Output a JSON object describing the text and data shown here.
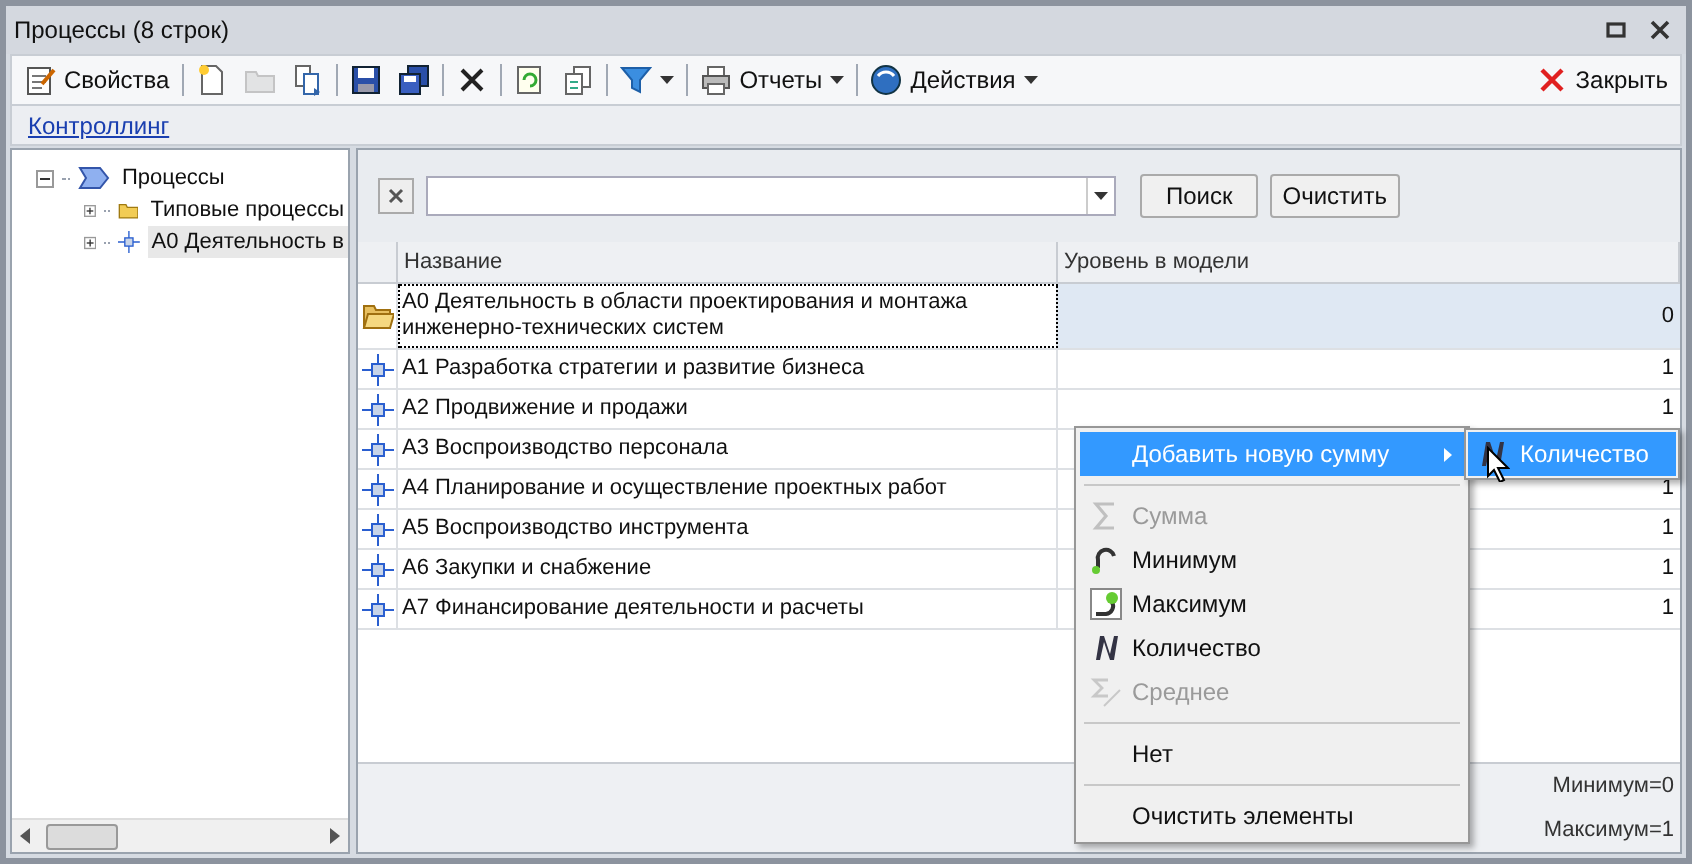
{
  "window": {
    "title": "Процессы (8 строк)"
  },
  "toolbar": [
    {
      "kind": "button",
      "label": "Свойства",
      "disabled": false
    },
    {
      "kind": "separator"
    },
    {
      "kind": "button",
      "disabled": false
    },
    {
      "kind": "button",
      "disabled": true
    },
    {
      "kind": "button",
      "disabled": false
    },
    {
      "kind": "separator"
    },
    {
      "kind": "button",
      "disabled": false
    },
    {
      "kind": "button",
      "disabled": false
    },
    {
      "kind": "separator"
    },
    {
      "kind": "button",
      "disabled": false
    },
    {
      "kind": "separator"
    },
    {
      "kind": "button",
      "disabled": false
    },
    {
      "kind": "button",
      "disabled": false
    },
    {
      "kind": "separator"
    },
    {
      "kind": "dropdown",
      "disabled": false
    },
    {
      "kind": "separator"
    },
    {
      "kind": "dropdown",
      "label": "Отчеты",
      "disabled": false
    },
    {
      "kind": "separator"
    },
    {
      "kind": "dropdown",
      "label": "Действия",
      "disabled": false
    }
  ],
  "close_button": "Закрыть",
  "breadcrumb": "Контроллинг",
  "tree": [
    {
      "kind": "root",
      "label": "Процессы",
      "expanded": true,
      "selected": false,
      "children": [
        {
          "kind": "folder",
          "label": "Типовые процессы",
          "expanded": false,
          "selected": false
        },
        {
          "kind": "process",
          "label": "А0 Деятельность в",
          "expanded": false,
          "selected": true
        }
      ]
    }
  ],
  "search": {
    "button": "Поиск",
    "clear_button": "Очистить"
  },
  "table": {
    "columns": [
      "Название",
      "Уровень в модели"
    ],
    "rows": [
      {
        "kind": "folder",
        "name": "А0 Деятельность в области проектирования и монтажа инженерно-технических систем",
        "level": "0",
        "selected": true
      },
      {
        "kind": "process",
        "name": "А1 Разработка стратегии и развитие бизнеса",
        "level": "1",
        "selected": false
      },
      {
        "kind": "process",
        "name": "А2 Продвижение и продажи",
        "level": "1",
        "selected": false
      },
      {
        "kind": "process",
        "name": "А3 Воспроизводство персонала",
        "selected": false
      },
      {
        "kind": "process",
        "name": "А4 Планирование и осуществление проектных работ",
        "level": "1",
        "selected": false
      },
      {
        "kind": "process",
        "name": "А5 Воспроизводство инструмента",
        "level": "1",
        "selected": false
      },
      {
        "kind": "process",
        "name": "А6 Закупки и снабжение",
        "level": "1",
        "selected": false
      },
      {
        "kind": "process",
        "name": "А7 Финансирование деятельности и расчеты",
        "level": "1",
        "selected": false
      }
    ],
    "totals": [
      "Минимум=0",
      "Максимум=1"
    ]
  },
  "context_menu": {
    "items": [
      {
        "kind": "submenu",
        "label": "Добавить новую сумму",
        "highlighted": true
      },
      {
        "kind": "separator"
      },
      {
        "kind": "item",
        "label": "Сумма",
        "disabled": true
      },
      {
        "kind": "item",
        "label": "Минимум",
        "disabled": false
      },
      {
        "kind": "item",
        "label": "Максимум",
        "disabled": false
      },
      {
        "kind": "item",
        "label": "Количество",
        "disabled": false
      },
      {
        "kind": "item",
        "label": "Среднее",
        "disabled": true
      },
      {
        "kind": "separator"
      },
      {
        "kind": "item",
        "label": "Нет",
        "disabled": false
      },
      {
        "kind": "separator"
      },
      {
        "kind": "item",
        "label": "Очистить элементы",
        "disabled": false
      }
    ],
    "submenu": [
      {
        "label": "Количество",
        "highlighted": true
      }
    ]
  }
}
